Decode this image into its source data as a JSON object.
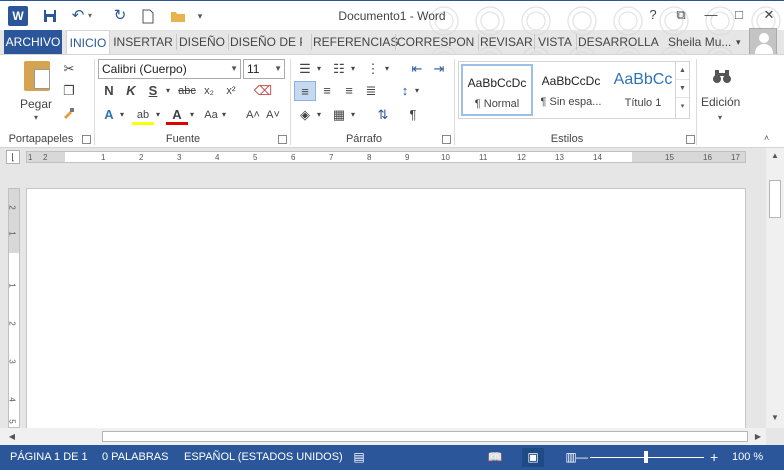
{
  "window": {
    "title": "Documento1 - Word",
    "app_icon": "W"
  },
  "quick_access": [
    "save-icon",
    "undo-icon",
    "redo-icon",
    "new-document-icon",
    "open-folder-icon",
    "customize-qat-icon"
  ],
  "window_controls": {
    "help": "?",
    "ribbon_options": "⧉",
    "minimize": "—",
    "maximize": "□",
    "close": "✕"
  },
  "tabs": [
    {
      "label": "ARCHIVO"
    },
    {
      "label": "INICIO"
    },
    {
      "label": "INSERTAR"
    },
    {
      "label": "DISEÑO"
    },
    {
      "label": "DISEÑO DE P"
    },
    {
      "label": "REFERENCIAS"
    },
    {
      "label": "CORRESPON"
    },
    {
      "label": "REVISAR"
    },
    {
      "label": "VISTA"
    },
    {
      "label": "DESARROLLA"
    }
  ],
  "user": {
    "name": "Sheila Mu...",
    "dropdown": "▾"
  },
  "ribbon": {
    "clipboard": {
      "paste_label": "Pegar",
      "group_label": "Portapapeles"
    },
    "font": {
      "font_name": "Calibri (Cuerpo)",
      "font_size": "11",
      "group_label": "Fuente",
      "buttons": {
        "bold": "N",
        "italic": "K",
        "underline": "S",
        "strikethrough": "abc",
        "subscript": "x₂",
        "superscript": "x²",
        "text_effects": "A",
        "highlight": "ab",
        "font_color": "A",
        "change_case": "Aa",
        "grow": "A˄",
        "shrink": "A˅"
      }
    },
    "paragraph": {
      "group_label": "Párrafo",
      "show_marks": "¶"
    },
    "styles": {
      "group_label": "Estilos",
      "items": [
        {
          "sample": "AaBbCcDc",
          "name": "¶ Normal"
        },
        {
          "sample": "AaBbCcDc",
          "name": "¶ Sin espa..."
        },
        {
          "sample": "AaBbCc",
          "name": "Título 1"
        }
      ]
    },
    "editing": {
      "label": "Edición"
    }
  },
  "ruler": {
    "numbers": [
      "1",
      "2",
      "1",
      "2",
      "3",
      "4",
      "5",
      "6",
      "7",
      "8",
      "9",
      "10",
      "11",
      "12",
      "13",
      "14",
      "15",
      "16",
      "17"
    ],
    "vertical_numbers": [
      "2",
      "1",
      "1",
      "2",
      "3",
      "4",
      "5"
    ]
  },
  "status_bar": {
    "page": "PÁGINA 1 DE 1",
    "words": "0 PALABRAS",
    "language": "ESPAÑOL (ESTADOS UNIDOS)",
    "zoom": "100 %",
    "zoom_out": "—",
    "zoom_in": "+",
    "zoom_level_percent": 100
  },
  "colors": {
    "accent": "#2b579a",
    "status_bar": "#2b579a",
    "heading_style": "#2e74b5"
  }
}
